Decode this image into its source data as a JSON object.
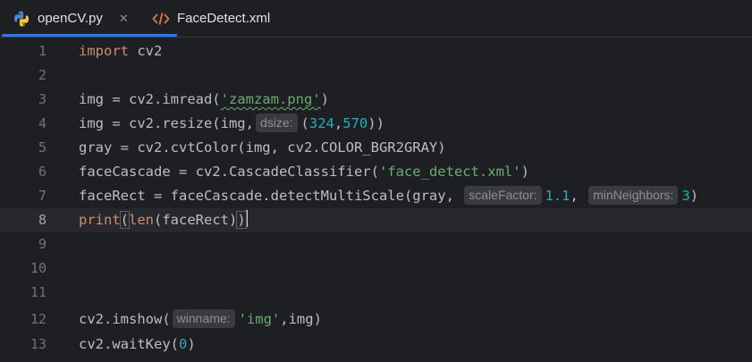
{
  "tabs": [
    {
      "label": "openCV.py",
      "icon": "python-icon",
      "active": true
    },
    {
      "label": "FaceDetect.xml",
      "icon": "xml-icon",
      "active": false
    }
  ],
  "colors": {
    "accent": "#3574f0",
    "keyword": "#cf8e6d",
    "string": "#6aab73",
    "number": "#2aacb8"
  },
  "lines": {
    "n1": "1",
    "n2": "2",
    "n3": "3",
    "n4": "4",
    "n5": "5",
    "n6": "6",
    "n7": "7",
    "n8": "8",
    "n9": "9",
    "n10": "10",
    "n11": "11",
    "n12": "12",
    "n13": "13",
    "l1_kw": "import",
    "l1_rest": " cv2",
    "l3_a": "img = cv2.imread(",
    "l3_str": "'zamzam.png'",
    "l3_b": ")",
    "l4_a": "img = cv2.resize(img,",
    "l4_hint": "dsize:",
    "l4_b": "(",
    "l4_n1": "324",
    "l4_c": ",",
    "l4_n2": "570",
    "l4_d": "))",
    "l5": "gray = cv2.cvtColor(img, cv2.COLOR_BGR2GRAY)",
    "l6_a": "faceCascade = cv2.CascadeClassifier(",
    "l6_str": "'face_detect.xml'",
    "l6_b": ")",
    "l7_a": "faceRect = faceCascade.detectMultiScale(gray, ",
    "l7_hint1": "scaleFactor:",
    "l7_n1": "1.1",
    "l7_b": ", ",
    "l7_hint2": "minNeighbors:",
    "l7_n2": "3",
    "l7_c": ")",
    "l8_fn": "print",
    "l8_a": "(",
    "l8_fn2": "len",
    "l8_b": "(faceRect)",
    "l8_c": ")",
    "l12_a": "cv2.imshow(",
    "l12_hint": "winname:",
    "l12_str": "'img'",
    "l12_b": ",img)",
    "l13_a": "cv2.waitKey(",
    "l13_n": "0",
    "l13_b": ")"
  }
}
